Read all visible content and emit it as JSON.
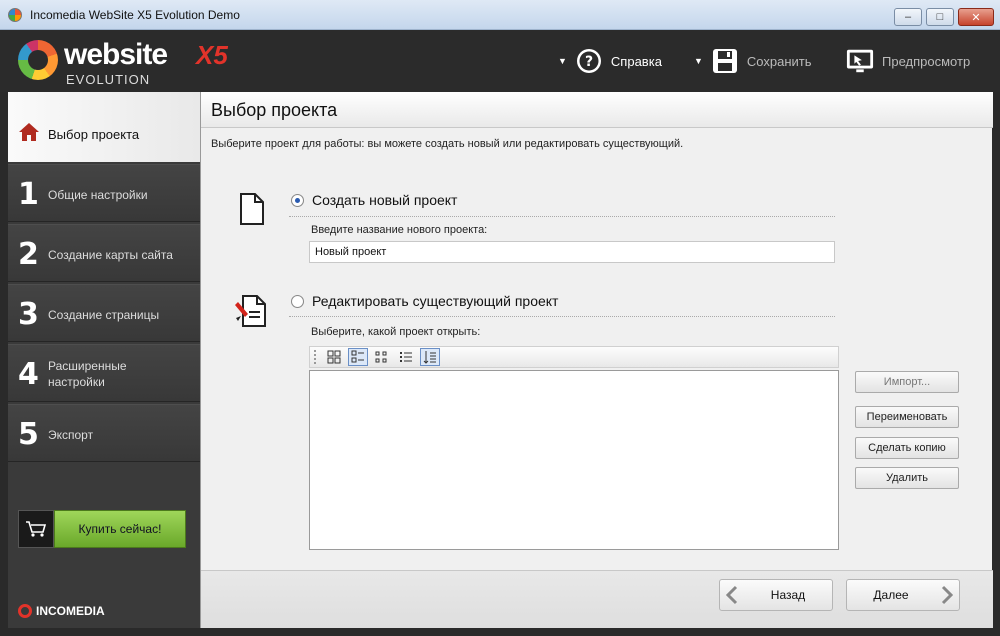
{
  "window": {
    "title": "Incomedia WebSite X5 Evolution Demo",
    "buttons": {
      "minimize": "–",
      "maximize": "□",
      "close": "✕"
    }
  },
  "logo": {
    "word": "website",
    "version": "X5",
    "edition": "EVOLUTION"
  },
  "header": {
    "help": {
      "label": "Справка",
      "icon": "help-icon"
    },
    "save": {
      "label": "Сохранить",
      "icon": "save-icon"
    },
    "preview": {
      "label": "Предпросмотр",
      "icon": "preview-icon"
    }
  },
  "sidebar": {
    "active": {
      "label": "Выбор проекта",
      "icon": "home-icon"
    },
    "items": [
      {
        "num": "1",
        "label": "Общие настройки"
      },
      {
        "num": "2",
        "label": "Создание карты сайта"
      },
      {
        "num": "3",
        "label": "Создание страницы"
      },
      {
        "num": "4",
        "label": "Расширенные",
        "label2": "настройки"
      },
      {
        "num": "5",
        "label": "Экспорт"
      }
    ],
    "buy_label": "Купить сейчас!",
    "brand": "INCOMEDIA"
  },
  "main": {
    "title": "Выбор проекта",
    "description": "Выберите проект для работы: вы можете создать новый или редактировать существующий.",
    "create": {
      "label": "Создать новый проект",
      "selected": true,
      "field_label": "Введите название нового проекта:",
      "field_value": "Новый проект"
    },
    "edit": {
      "label": "Редактировать существующий проект",
      "selected": false,
      "list_label": "Выберите, какой проект открыть:",
      "projects": []
    },
    "actions": {
      "import": "Импорт...",
      "rename": "Переименовать",
      "copy": "Сделать копию",
      "delete": "Удалить"
    },
    "nav": {
      "back": "Назад",
      "next": "Далее"
    }
  },
  "colors": {
    "accent_red": "#e2332a",
    "buy_green": "#8cc63f",
    "sidebar": "#3a3a3a",
    "header": "#2b2b2b"
  }
}
